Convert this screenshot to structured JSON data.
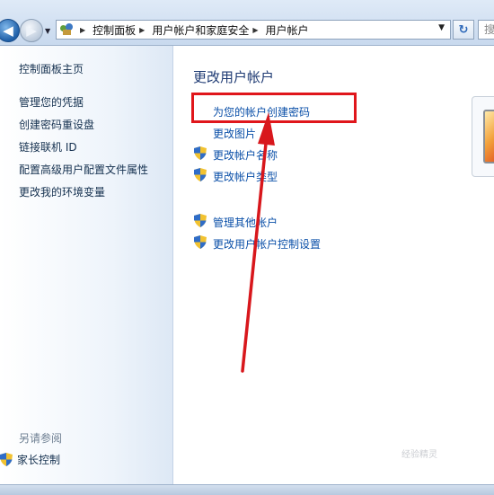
{
  "address_bar": {
    "breadcrumbs": [
      "控制面板",
      "用户帐户和家庭安全",
      "用户帐户"
    ],
    "search_placeholder": "搜"
  },
  "sidebar": {
    "home_link": "控制面板主页",
    "items": [
      "管理您的凭据",
      "创建密码重设盘",
      "链接联机 ID",
      "配置高级用户配置文件属性",
      "更改我的环境变量"
    ],
    "see_also_label": "另请参阅",
    "see_also_items": [
      "家长控制"
    ]
  },
  "main": {
    "title": "更改用户帐户",
    "links": [
      "为您的帐户创建密码",
      "更改图片"
    ],
    "shield_links": [
      "更改帐户名称",
      "更改帐户类型"
    ],
    "admin_links": [
      "管理其他帐户",
      "更改用户帐户控制设置"
    ]
  },
  "annotation": {
    "highlight_color": "#e0161b"
  },
  "watermark": "经验精灵"
}
